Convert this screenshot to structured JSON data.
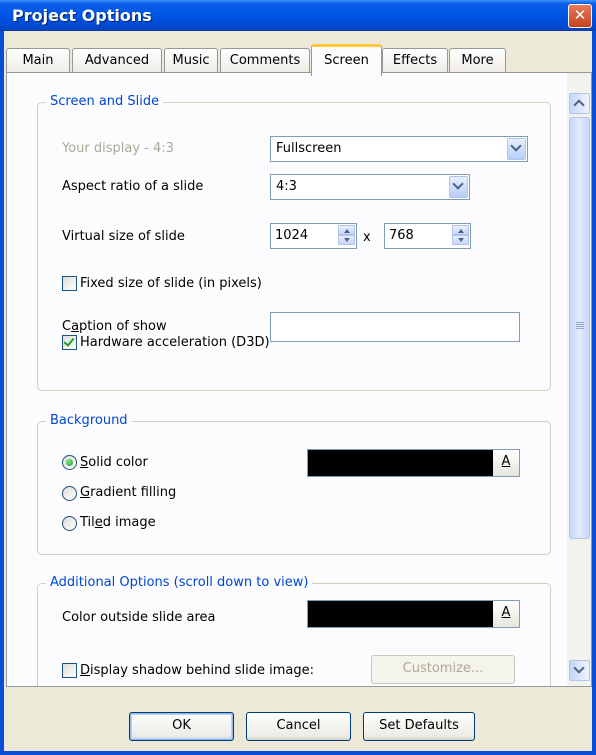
{
  "window": {
    "title": "Project Options",
    "close_label": "✕"
  },
  "tabs": [
    {
      "label": "Main"
    },
    {
      "label": "Advanced"
    },
    {
      "label": "Music"
    },
    {
      "label": "Comments"
    },
    {
      "label": "Screen",
      "active": true
    },
    {
      "label": "Effects"
    },
    {
      "label": "More"
    }
  ],
  "screen_and_slide": {
    "title": "Screen and Slide",
    "your_display_label": "Your display - 4:3",
    "your_display_value": "Fullscreen",
    "aspect_label": "Aspect ratio of a slide",
    "aspect_value": "4:3",
    "virtual_size_label": "Virtual size of slide",
    "virtual_width": "1024",
    "virtual_x": "x",
    "virtual_height": "768",
    "fixed_size_label": "Fixed size of slide (in pixels)",
    "fixed_size_checked": false,
    "caption_label_pre": "C",
    "caption_label_ul": "a",
    "caption_label_post": "ption of show",
    "caption_value": "",
    "hw_accel_label": "Hardware acceleration (D3D)",
    "hw_accel_checked": true
  },
  "background": {
    "title": "Background",
    "solid_pre": "",
    "solid_ul": "S",
    "solid_post": "olid color",
    "gradient_ul": "G",
    "gradient_post": "radient filling",
    "tiled_pre": "Til",
    "tiled_ul": "e",
    "tiled_post": "d image",
    "selected": "Solid color",
    "color_button_label": "A",
    "color_value": "#000000"
  },
  "additional": {
    "title": "Additional Options (scroll down to view)",
    "outside_color_label": "Color outside slide area",
    "outside_color_button_label": "A",
    "outside_color_value": "#000000",
    "shadow_pre": "",
    "shadow_ul": "D",
    "shadow_post": "isplay shadow behind slide image:",
    "shadow_checked": false,
    "customize_label": "Customize..."
  },
  "buttons": {
    "ok": "OK",
    "cancel": "Cancel",
    "defaults": "Set Defaults"
  },
  "colors": {
    "accent": "#0046d5",
    "titlebar": "#0055e5",
    "tab_highlight": "#ffc83c"
  }
}
